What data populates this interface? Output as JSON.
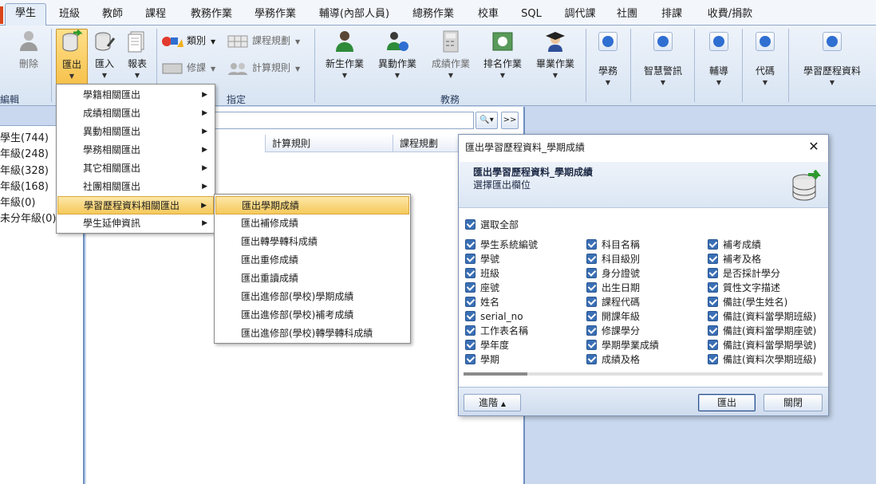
{
  "tabs": [
    {
      "label": "學生",
      "active": true
    },
    {
      "label": "班級"
    },
    {
      "label": "教師"
    },
    {
      "label": "課程"
    },
    {
      "label": "教務作業"
    },
    {
      "label": "學務作業"
    },
    {
      "label": "輔導(內部人員)"
    },
    {
      "label": "總務作業"
    },
    {
      "label": "校車"
    },
    {
      "label": "SQL"
    },
    {
      "label": "調代課"
    },
    {
      "label": "社團"
    },
    {
      "label": "排課"
    },
    {
      "label": "收費/捐款"
    }
  ],
  "ribbon": {
    "delete_label": "刪除",
    "edit_group": "編輯",
    "export_label": "匯出",
    "import_label": "匯入",
    "report_label": "報表",
    "category_label": "類別",
    "repair_label": "修課",
    "course_plan_label": "課程規劃",
    "calc_rule_label": "計算規則",
    "assign_group": "指定",
    "new_student_label": "新生作業",
    "transfer_label": "異動作業",
    "grades_label": "成績作業",
    "ranking_label": "排名作業",
    "graduation_label": "畢業作業",
    "academic_group": "教務",
    "student_affairs_label": "學務",
    "smart_alert_label": "智慧警訊",
    "counseling_label": "輔導",
    "code_label": "代碼",
    "portfolio_label": "學習歷程資料"
  },
  "tree": [
    "學生(744)",
    "年級(248)",
    "年級(328)",
    "年級(168)",
    "年級(0)",
    "未分年級(0)"
  ],
  "grid": {
    "search_value": "",
    "search_button": "🔍▾",
    "more_button": ">>",
    "columns": [
      "計算規則",
      "課程規劃"
    ]
  },
  "export_menu": [
    "學籍相關匯出",
    "成績相關匯出",
    "異動相關匯出",
    "學務相關匯出",
    "其它相關匯出",
    "社團相關匯出",
    "學習歷程資料相關匯出",
    "學生延伸資訊"
  ],
  "portfolio_submenu": [
    "匯出學期成績",
    "匯出補修成績",
    "匯出轉學轉科成績",
    "匯出重修成績",
    "匯出重讀成績",
    "匯出進修部(學校)學期成績",
    "匯出進修部(學校)補考成績",
    "匯出進修部(學校)轉學轉科成績"
  ],
  "dialog": {
    "title": "匯出學習歷程資料_學期成績",
    "close": "✕",
    "banner_title": "匯出學習歷程資料_學期成績",
    "banner_subtitle": "選擇匯出欄位",
    "select_all": "選取全部",
    "fields_col1": [
      "學生系統編號",
      "學號",
      "班級",
      "座號",
      "姓名",
      "serial_no",
      "工作表名稱",
      "學年度",
      "學期"
    ],
    "fields_col2": [
      "科目名稱",
      "科目級別",
      "身分證號",
      "出生日期",
      "課程代碼",
      "開課年級",
      "修課學分",
      "學期學業成績",
      "成績及格"
    ],
    "fields_col3": [
      "補考成績",
      "補考及格",
      "是否採計學分",
      "質性文字描述",
      "備註(學生姓名)",
      "備註(資料當學期班級)",
      "備註(資料當學期座號)",
      "備註(資料當學期學號)",
      "備註(資料次學期班級)"
    ],
    "advanced_button": "進階",
    "export_button": "匯出",
    "close_button": "關閉"
  },
  "colors": {
    "accent": "#2f6fd1",
    "highlight": "#f5c95a",
    "checkbox": "#3a6fb5",
    "panel_bg": "#c9d8ee"
  }
}
